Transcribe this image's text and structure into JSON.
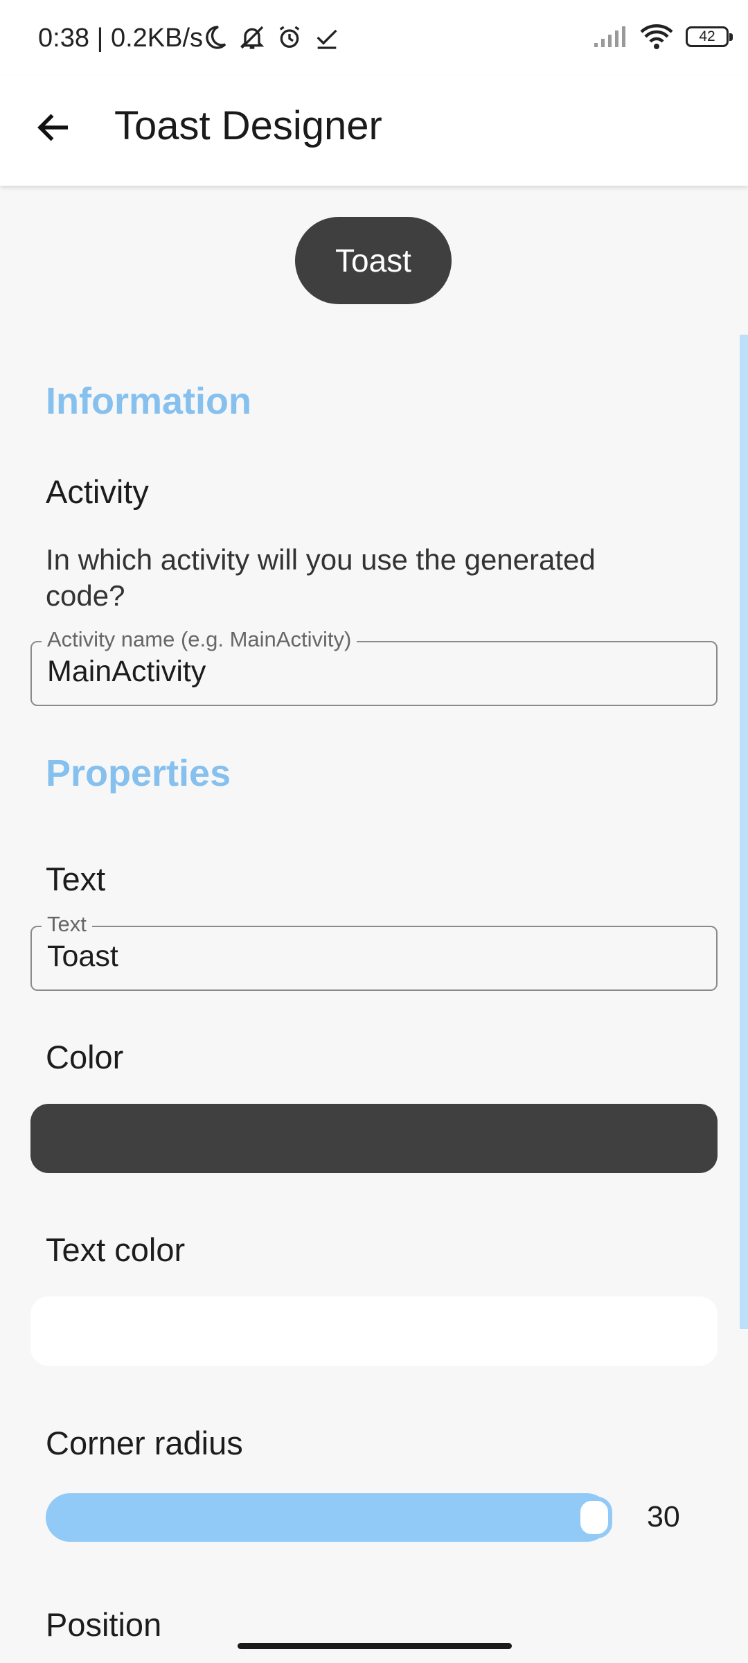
{
  "status_bar": {
    "time": "0:38 | 0.2KB/s",
    "icons": [
      "moon-icon",
      "mute-bell-icon",
      "alarm-icon",
      "check-icon",
      "signal-icon",
      "wifi-icon",
      "battery-icon"
    ],
    "battery": "42"
  },
  "app_bar": {
    "title": "Toast Designer",
    "back_icon": "arrow-back-icon"
  },
  "preview": {
    "toast_text": "Toast",
    "toast_color": "#3f3f3f"
  },
  "information": {
    "heading": "Information",
    "activity_label": "Activity",
    "activity_description": "In which activity will you use the generated code?",
    "activity_field_label": "Activity name (e.g. MainActivity)",
    "activity_field_value": "MainActivity"
  },
  "properties": {
    "heading": "Properties",
    "text_label": "Text",
    "text_field_label": "Text",
    "text_field_value": "Toast",
    "color_label": "Color",
    "color_value": "#404040",
    "text_color_label": "Text color",
    "text_color_value": "#ffffff",
    "corner_radius_label": "Corner radius",
    "corner_radius_value": "30",
    "position_label": "Position"
  },
  "accent_color": "#86c0ee"
}
